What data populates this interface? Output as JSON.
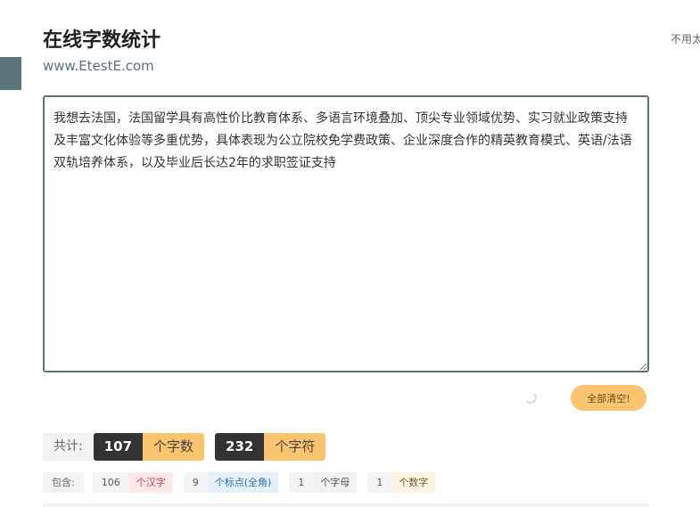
{
  "header": {
    "title": "在线字数统计",
    "subtitle": "www.EtestE.com",
    "top_right_text": "不用太"
  },
  "editor": {
    "value": "我想去法国，法国留学具有高性价比教育体系、多语言环境叠加、顶尖专业领域优势、实习就业政策支持及丰富文化体验等多重优势，具体表现为公立院校免学费政策、企业深度合作的精英教育模式、英语/法语双轨培养体系，以及毕业后长达2年的求职签证支持"
  },
  "actions": {
    "clear_label": "全部清空!"
  },
  "totals": {
    "label": "共计:",
    "words_count": "107",
    "words_unit": "个字数",
    "chars_count": "232",
    "chars_unit": "个字符"
  },
  "contains": {
    "label": "包含:",
    "items": [
      {
        "count": "106",
        "unit": "个汉字"
      },
      {
        "count": "9",
        "unit": "个标点(全角)"
      },
      {
        "count": "1",
        "unit": "个字母"
      },
      {
        "count": "1",
        "unit": "个数字"
      }
    ]
  },
  "colors": {
    "accent": "#fbc46f",
    "dark": "#333333",
    "editor_border": "#5b7578"
  }
}
